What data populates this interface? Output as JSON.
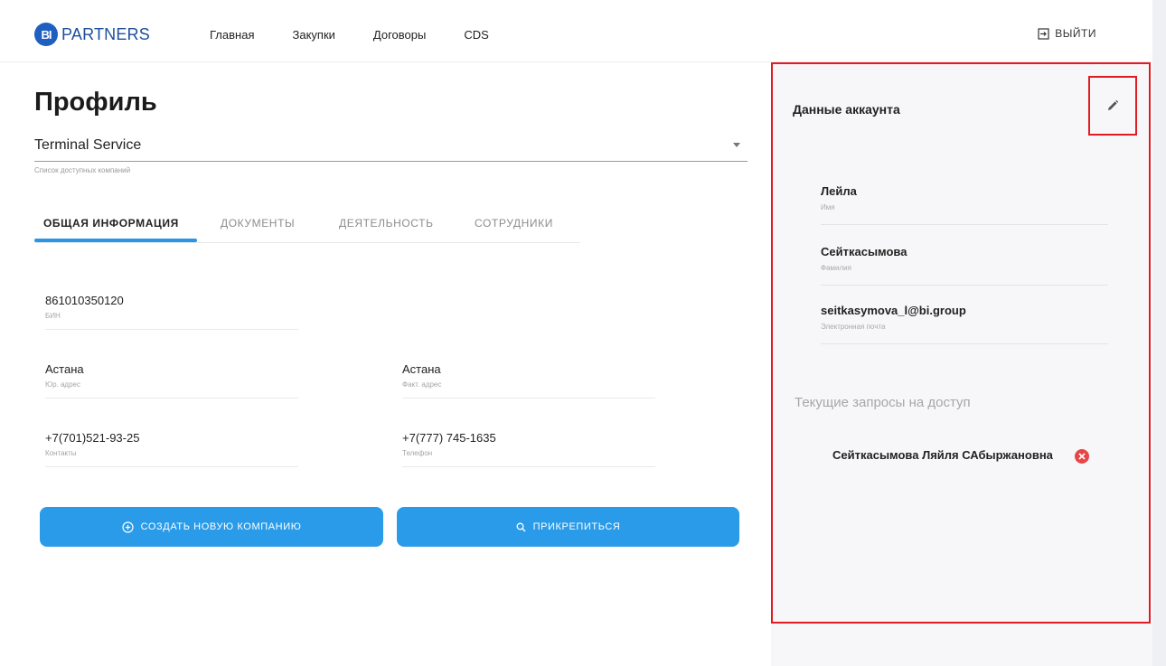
{
  "brand": {
    "logo_mark": "BI",
    "name": "PARTNERS",
    "accent": "#2a9be8",
    "highlight": "#e11b22"
  },
  "nav": {
    "items": [
      "Главная",
      "Закупки",
      "Договоры",
      "CDS"
    ],
    "logout_label": "ВЫЙТИ"
  },
  "profile": {
    "title": "Профиль",
    "company": "Terminal Service",
    "company_hint": "Список доступных компаний",
    "tabs": [
      "ОБЩАЯ ИНФОРМАЦИЯ",
      "ДОКУМЕНТЫ",
      "ДЕЯТЕЛЬНОСТЬ",
      "СОТРУДНИКИ"
    ],
    "fields": {
      "bin": {
        "value": "861010350120",
        "label": "БИН"
      },
      "legal_address": {
        "value": "Астана",
        "label": "Юр. адрес"
      },
      "actual_address": {
        "value": "Астана",
        "label": "Факт. адрес"
      },
      "contacts": {
        "value": "+7(701)521-93-25",
        "label": "Контакты"
      },
      "phone": {
        "value": "+7(777) 745-1635",
        "label": "Телефон"
      }
    },
    "buttons": {
      "create": "СОЗДАТЬ НОВУЮ КОМПАНИЮ",
      "attach": "ПРИКРЕПИТЬСЯ"
    }
  },
  "account": {
    "title": "Данные аккаунта",
    "first_name": {
      "value": "Лейла",
      "label": "Имя"
    },
    "last_name": {
      "value": "Сейткасымова",
      "label": "Фамилия"
    },
    "email": {
      "value": "seitkasymova_l@bi.group",
      "label": "Электронная почта"
    },
    "requests_title": "Текущие запросы на доступ",
    "requests": [
      "Сейткасымова Ляйля САбыржановна"
    ]
  }
}
